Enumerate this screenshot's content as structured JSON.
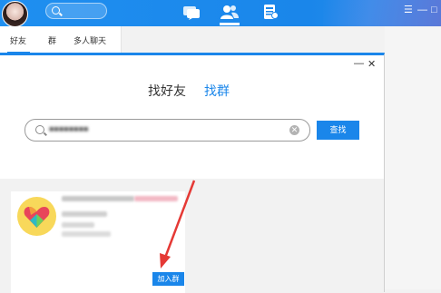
{
  "header": {
    "window_controls": [
      "☰",
      "—",
      "□"
    ]
  },
  "tabs": [
    {
      "label": "好友",
      "active": true
    },
    {
      "label": "群",
      "active": false
    },
    {
      "label": "多人聊天",
      "active": false
    }
  ],
  "popup": {
    "window_controls": [
      "—",
      "✕"
    ],
    "mode_tabs": [
      {
        "label": "找好友",
        "active": false
      },
      {
        "label": "找群",
        "active": true
      }
    ],
    "search": {
      "value": "■■■■■■■■",
      "clear_glyph": "✕"
    },
    "find_button": "查找",
    "result": {
      "join_button": "加入群"
    }
  },
  "colors": {
    "accent": "#1a86ea",
    "arrow": "#e53935"
  }
}
